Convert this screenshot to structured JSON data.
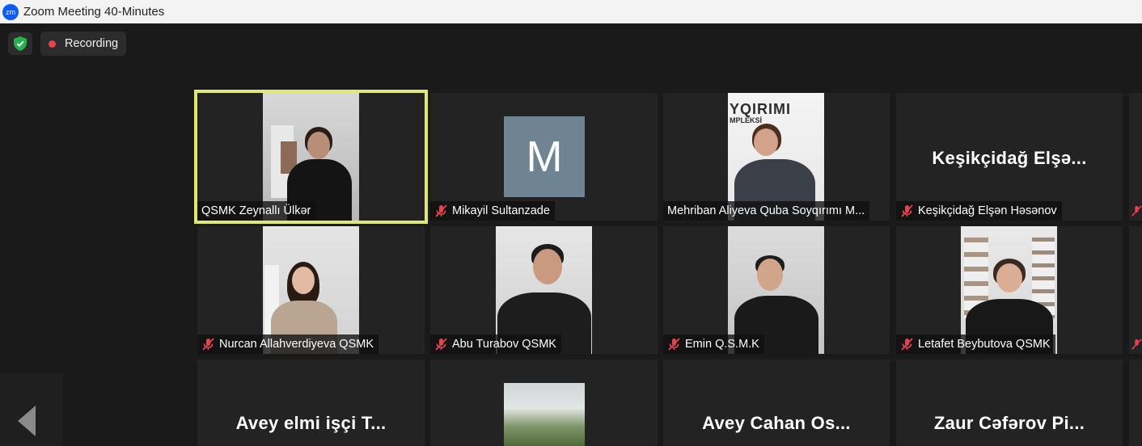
{
  "window": {
    "logo": "zm",
    "title": "Zoom Meeting 40-Minutes"
  },
  "status": {
    "security_icon": "shield-check-icon",
    "recording_label": "Recording"
  },
  "colors": {
    "active_speaker": "#dfe870",
    "muted": "#e9424c",
    "recording_dot": "#e9424c",
    "avatar_bg": "#6f8493"
  },
  "participants": [
    {
      "name": "QSMK Zeynallı Ülkər",
      "muted": false,
      "active": true,
      "video": true
    },
    {
      "name": "Mikayil Sultanzade",
      "muted": true,
      "avatar_letter": "M",
      "video": false
    },
    {
      "name": "Mehriban Aliyeva Quba Soyqırımı  M...",
      "muted": false,
      "video": true,
      "backdrop_text_1": "YQIRIMI",
      "backdrop_text_2": "MPLEKSİ"
    },
    {
      "name": "Keşikçidağ Elşən Həsənov",
      "muted": true,
      "video": false,
      "display_name": "Keşikçidağ  Elşə..."
    },
    {
      "name": "Nurcan Allahverdiyeva QSMK",
      "muted": true,
      "video": true
    },
    {
      "name": "Abu Turabov QSMK",
      "muted": true,
      "video": true
    },
    {
      "name": "Emin Q.S.M.K",
      "muted": true,
      "video": true
    },
    {
      "name": "Letafet Beybutova QSMK",
      "muted": true,
      "video": true
    },
    {
      "display_name": "Avey elmi işçi T...",
      "video": false
    },
    {
      "video": true,
      "thumbnail": "landscape"
    },
    {
      "display_name": "Avey  Cahan  Os...",
      "video": false
    },
    {
      "display_name": "Zaur  Cəfərov  Pi...",
      "video": false
    }
  ],
  "nav": {
    "previous_icon": "triangle-left-icon"
  }
}
